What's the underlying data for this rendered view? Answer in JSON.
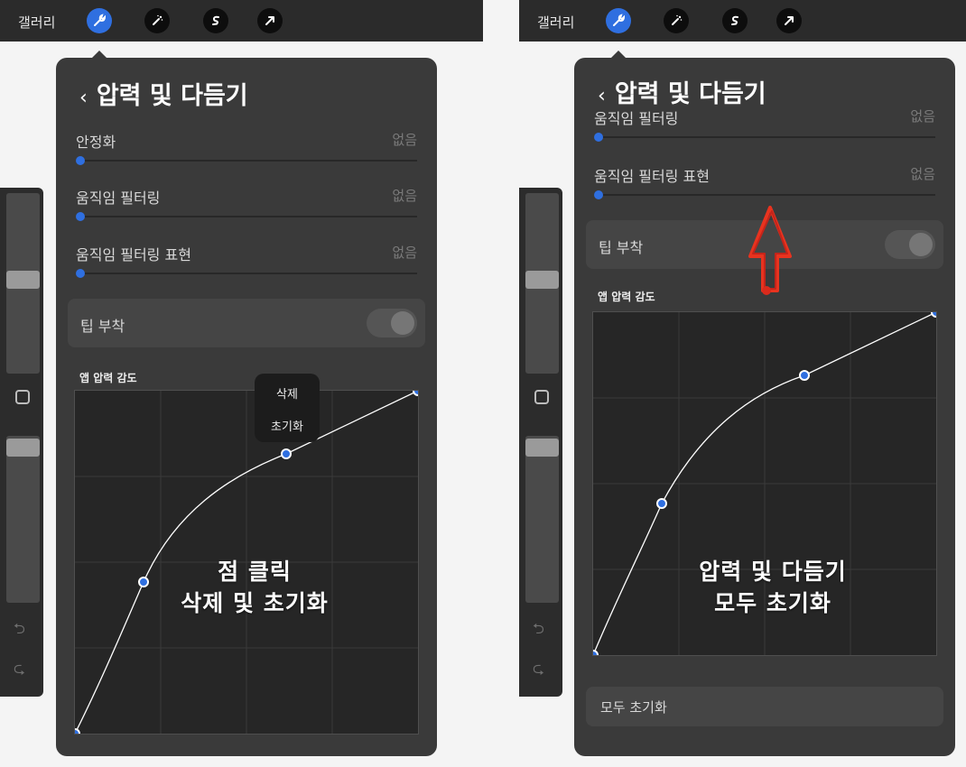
{
  "left": {
    "topbar": {
      "gallery": "갤러리",
      "icons": [
        "wrench-icon",
        "magic-wand-icon",
        "s-select-icon",
        "arrow-transform-icon"
      ]
    },
    "panel": {
      "title": "압력 및 다듬기",
      "rows": [
        {
          "label": "안정화",
          "value": "없음"
        },
        {
          "label": "움직임 필터링",
          "value": "없음"
        },
        {
          "label": "움직임 필터링 표현",
          "value": "없음"
        }
      ],
      "tip_label": "팁 부착",
      "section_label": "앱 압력 감도",
      "popup": {
        "delete": "삭제",
        "reset": "초기화"
      },
      "overlay": "점 클릭\n삭제 및 초기화"
    }
  },
  "right": {
    "topbar": {
      "gallery": "갤러리",
      "icons": [
        "wrench-icon",
        "magic-wand-icon",
        "s-select-icon",
        "arrow-transform-icon"
      ]
    },
    "panel": {
      "title": "압력 및 다듬기",
      "rows": [
        {
          "label": "움직임 필터링",
          "value": "없음"
        },
        {
          "label": "움직임 필터링 표현",
          "value": "없음"
        }
      ],
      "tip_label": "팁 부착",
      "section_label": "앱 압력 감도",
      "overlay": "압력 및 다듬기\n모두 초기화",
      "reset_all": "모두 초기화"
    }
  },
  "colors": {
    "accent": "#2f6fe0",
    "panel": "#3a3a3a",
    "annotation": "#e8331f"
  }
}
